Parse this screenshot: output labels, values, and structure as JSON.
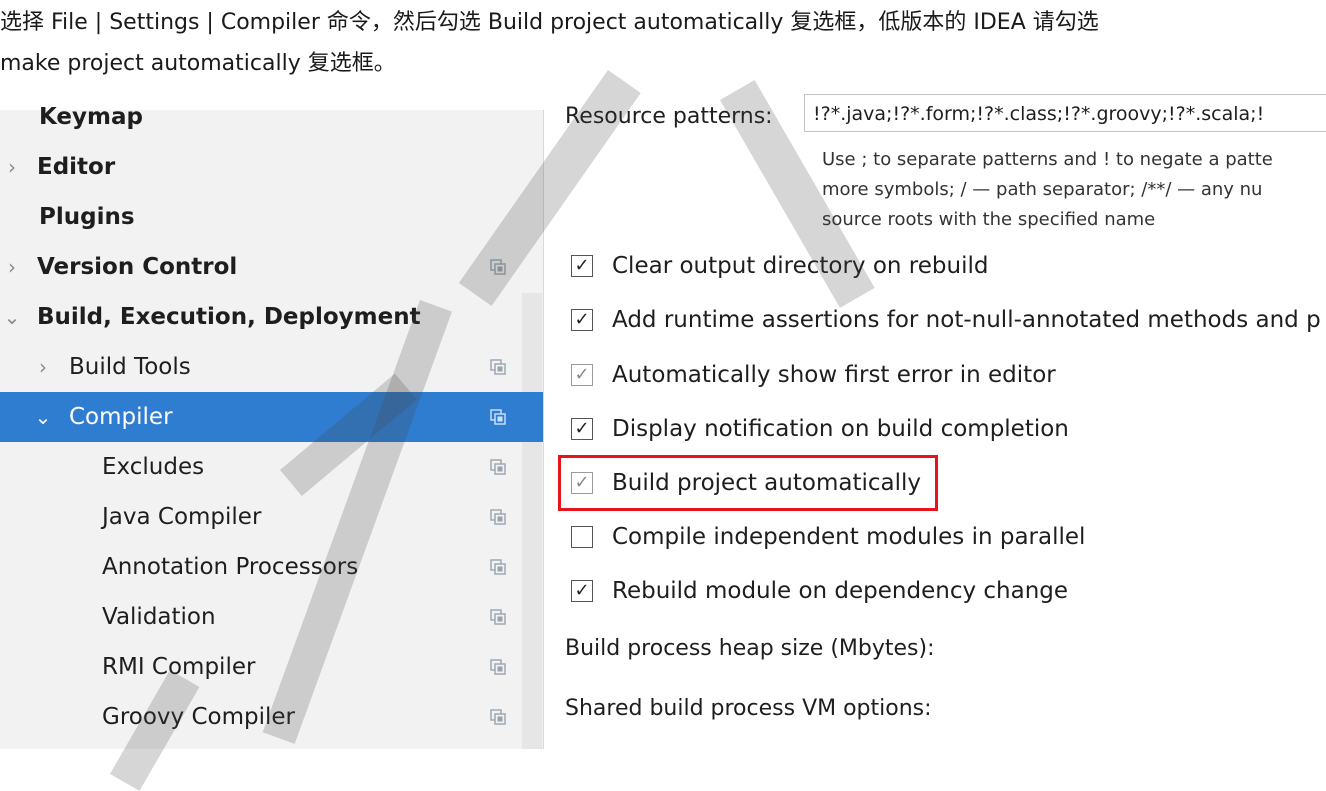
{
  "caption": {
    "line1": "选择 File | Settings | Compiler 命令，然后勾选 Build project automatically 复选框，低版本的 IDEA 请勾选",
    "line2": "make project automatically 复选框。"
  },
  "sidebar": {
    "items": [
      {
        "label": "Keymap",
        "arrow": "",
        "bold": true,
        "indent": 0,
        "project_icon": false
      },
      {
        "label": "Editor",
        "arrow": "›",
        "bold": true,
        "indent": 0,
        "project_icon": false
      },
      {
        "label": "Plugins",
        "arrow": "",
        "bold": true,
        "indent": 0,
        "project_icon": false
      },
      {
        "label": "Version Control",
        "arrow": "›",
        "bold": true,
        "indent": 0,
        "project_icon": true
      },
      {
        "label": "Build, Execution, Deployment",
        "arrow": "⌄",
        "bold": true,
        "indent": 0,
        "project_icon": false
      },
      {
        "label": "Build Tools",
        "arrow": "›",
        "bold": false,
        "indent": 1,
        "project_icon": true
      },
      {
        "label": "Compiler",
        "arrow": "⌄",
        "bold": false,
        "indent": 1,
        "project_icon": true,
        "selected": true
      },
      {
        "label": "Excludes",
        "arrow": "",
        "bold": false,
        "indent": 2,
        "project_icon": true
      },
      {
        "label": "Java Compiler",
        "arrow": "",
        "bold": false,
        "indent": 2,
        "project_icon": true
      },
      {
        "label": "Annotation Processors",
        "arrow": "",
        "bold": false,
        "indent": 2,
        "project_icon": true
      },
      {
        "label": "Validation",
        "arrow": "",
        "bold": false,
        "indent": 2,
        "project_icon": true
      },
      {
        "label": "RMI Compiler",
        "arrow": "",
        "bold": false,
        "indent": 2,
        "project_icon": true
      },
      {
        "label": "Groovy Compiler",
        "arrow": "",
        "bold": false,
        "indent": 2,
        "project_icon": true
      }
    ],
    "selected_color": "#2f7dd1"
  },
  "main": {
    "resource_patterns_label": "Resource patterns:",
    "resource_patterns_value": "!?*.java;!?*.form;!?*.class;!?*.groovy;!?*.scala;!",
    "hint_line1": "Use ; to separate patterns and ! to negate a patte",
    "hint_line2": "more symbols; / — path separator; /**/ — any nu",
    "hint_line3": "source roots with the specified name",
    "checkboxes": [
      {
        "label": "Clear output directory on rebuild",
        "checked": true,
        "dim": false
      },
      {
        "label": "Add runtime assertions for not-null-annotated methods and p",
        "checked": true,
        "dim": false
      },
      {
        "label": "Automatically show first error in editor",
        "checked": true,
        "dim": true
      },
      {
        "label": "Display notification on build completion",
        "checked": true,
        "dim": false
      },
      {
        "label": "Build project automatically",
        "checked": true,
        "dim": true,
        "highlighted": true
      },
      {
        "label": "Compile independent modules in parallel",
        "checked": false,
        "dim": false
      },
      {
        "label": "Rebuild module on dependency change",
        "checked": true,
        "dim": false
      }
    ],
    "heap_size_label": "Build process heap size (Mbytes):",
    "vm_options_label": "Shared build process VM options:",
    "highlight_color": "#e8141b"
  }
}
